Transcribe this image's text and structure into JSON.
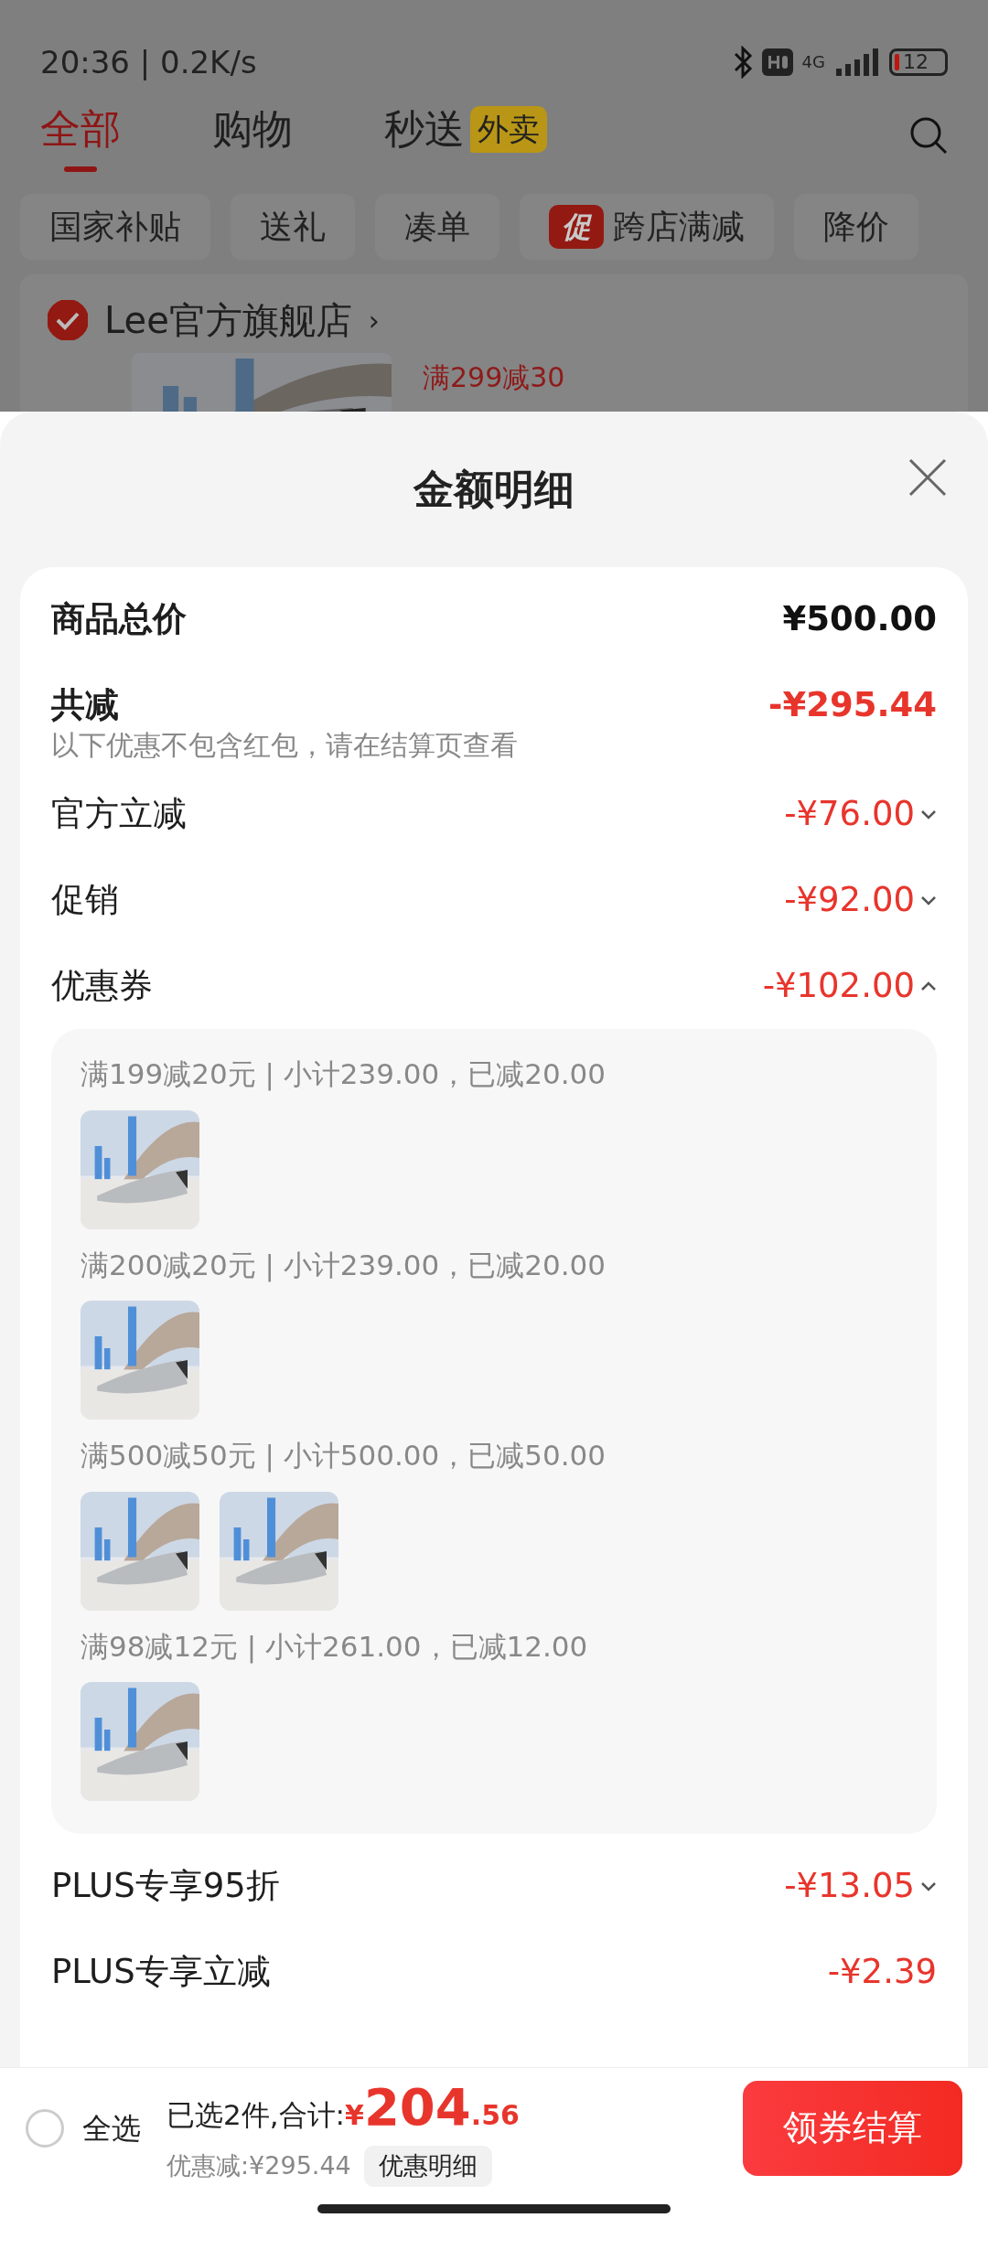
{
  "status_bar": {
    "time": "20:36 | 0.2K/s",
    "network": "4G",
    "battery": "12"
  },
  "tabs": [
    {
      "label": "全部",
      "selected": true
    },
    {
      "label": "购物",
      "selected": false
    },
    {
      "label": "秒送",
      "selected": false,
      "badge": "外卖"
    }
  ],
  "chips": [
    {
      "label": "国家补贴"
    },
    {
      "label": "送礼"
    },
    {
      "label": "凑单"
    },
    {
      "label": "跨店满减",
      "tag": "促"
    },
    {
      "label": "降价"
    }
  ],
  "store": {
    "name": "Lee官方旗舰店",
    "arrow": "›",
    "checked": true,
    "promo": "满299减30"
  },
  "sheet": {
    "title": "金额明细",
    "total": {
      "label": "商品总价",
      "amount": "¥500.00"
    },
    "discount": {
      "label": "共减",
      "amount": "-¥295.44",
      "note": "以下优惠不包含红包，请在结算页查看"
    },
    "rows": [
      {
        "kind": "collapsible",
        "label": "官方立减",
        "amount": "-¥76.00",
        "expanded": false
      },
      {
        "kind": "collapsible",
        "label": "促销",
        "amount": "-¥92.00",
        "expanded": false
      },
      {
        "kind": "collapsible",
        "label": "优惠券",
        "amount": "-¥102.00",
        "expanded": true,
        "coupons": [
          {
            "text": "满199减20元 | 小计239.00，已减20.00"
          },
          {
            "text": "满200减20元 | 小计239.00，已减20.00"
          },
          {
            "text": "满500减50元 | 小计500.00，已减50.00"
          },
          {
            "text": "满98减12元 | 小计261.00，已减12.00"
          }
        ]
      },
      {
        "kind": "collapsible",
        "label": "PLUS专享95折",
        "amount": "-¥13.05",
        "expanded": false
      },
      {
        "kind": "fixed",
        "label": "PLUS专享立减",
        "amount": "-¥2.39"
      }
    ]
  },
  "bottom_bar": {
    "select_all": {
      "label": "全选",
      "checked": false
    },
    "summary": "已选2件,合计:",
    "price": {
      "currency": "¥",
      "integer": "204",
      "decimal": ".56"
    },
    "saving": "优惠减:¥295.44",
    "detail_button": "优惠明细",
    "checkout_button": "领券结算"
  }
}
